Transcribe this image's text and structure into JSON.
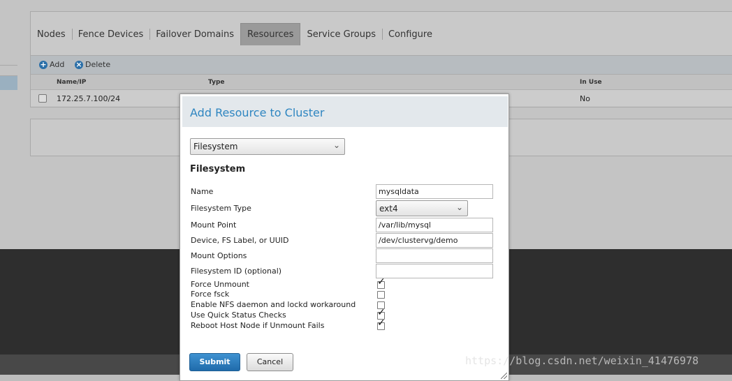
{
  "tabs": [
    {
      "label": "Nodes"
    },
    {
      "label": "Fence Devices"
    },
    {
      "label": "Failover Domains"
    },
    {
      "label": "Resources",
      "active": true
    },
    {
      "label": "Service Groups"
    },
    {
      "label": "Configure"
    }
  ],
  "toolbar": {
    "add_label": "Add",
    "delete_label": "Delete"
  },
  "table": {
    "columns": [
      "Name/IP",
      "Type",
      "In Use"
    ],
    "rows": [
      {
        "name": "172.25.7.100/24",
        "type": "",
        "in_use": "No"
      }
    ]
  },
  "dialog": {
    "title": "Add Resource to Cluster",
    "resource_type": "Filesystem",
    "section_title": "Filesystem",
    "fields": {
      "name": {
        "label": "Name",
        "value": "mysqldata"
      },
      "fs_type": {
        "label": "Filesystem Type",
        "value": "ext4"
      },
      "mount_point": {
        "label": "Mount Point",
        "value": "/var/lib/mysql"
      },
      "device": {
        "label": "Device, FS Label, or UUID",
        "value": "/dev/clustervg/demo"
      },
      "mount_options": {
        "label": "Mount Options",
        "value": ""
      },
      "fs_id": {
        "label": "Filesystem ID (optional)",
        "value": ""
      }
    },
    "checkboxes": [
      {
        "label": "Force Unmount",
        "checked": true
      },
      {
        "label": "Force fsck",
        "checked": false
      },
      {
        "label": "Enable NFS daemon and lockd workaround",
        "checked": false
      },
      {
        "label": "Use Quick Status Checks",
        "checked": true
      },
      {
        "label": "Reboot Host Node if Unmount Fails",
        "checked": true
      }
    ],
    "submit_label": "Submit",
    "cancel_label": "Cancel"
  },
  "watermark": "https://blog.csdn.net/weixin_41476978",
  "colors": {
    "accent": "#2f86c1",
    "primary_button": "#2a74b5"
  }
}
